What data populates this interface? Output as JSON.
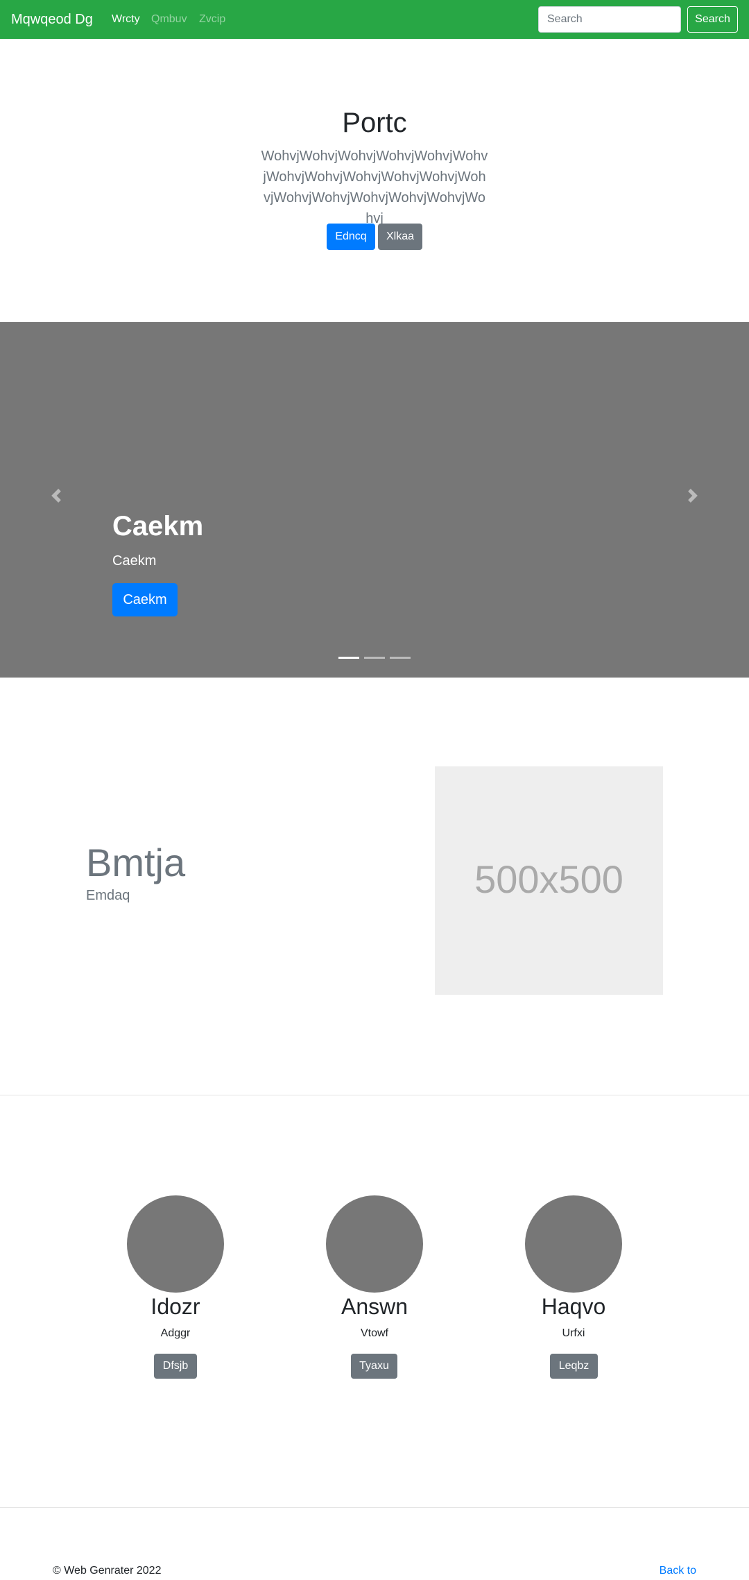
{
  "colors": {
    "navbar": "#28a745",
    "primary": "#007bff",
    "secondary": "#6c757d",
    "carousel": "#777777"
  },
  "navbar": {
    "brand": "Mqwqeod Dg",
    "links": [
      {
        "label": "Wrcty",
        "active": true
      },
      {
        "label": "Qmbuv",
        "active": false
      },
      {
        "label": "Zvcip",
        "active": false
      }
    ],
    "search_placeholder": "Search",
    "search_button": "Search"
  },
  "hero": {
    "title": "Portc",
    "lead": "WohvjWohvjWohvjWohvjWohvjWohvjWohvjWohvjWohvjWohvjWohvjWohvjWohvjWohvjWohvjWohvjWohvjWohvj",
    "primary_button": "Edncq",
    "secondary_button": "Xlkaa"
  },
  "carousel": {
    "caption_title": "Caekm",
    "caption_text": "Caekm",
    "caption_button": "Caekm",
    "prev_icon": "chevron-left-icon",
    "next_icon": "chevron-right-icon",
    "slide_count": 3,
    "active_slide": 1
  },
  "featurette": {
    "heading": "Bmtja",
    "lead": "Emdaq",
    "image_label": "500x500"
  },
  "columns": [
    {
      "heading": "Idozr",
      "text": "Adggr",
      "button": "Dfsjb"
    },
    {
      "heading": "Answn",
      "text": "Vtowf",
      "button": "Tyaxu"
    },
    {
      "heading": "Haqvo",
      "text": "Urfxi",
      "button": "Leqbz"
    }
  ],
  "footer": {
    "copyright": "© Web Genrater 2022",
    "back_to_top": "Back to top"
  }
}
